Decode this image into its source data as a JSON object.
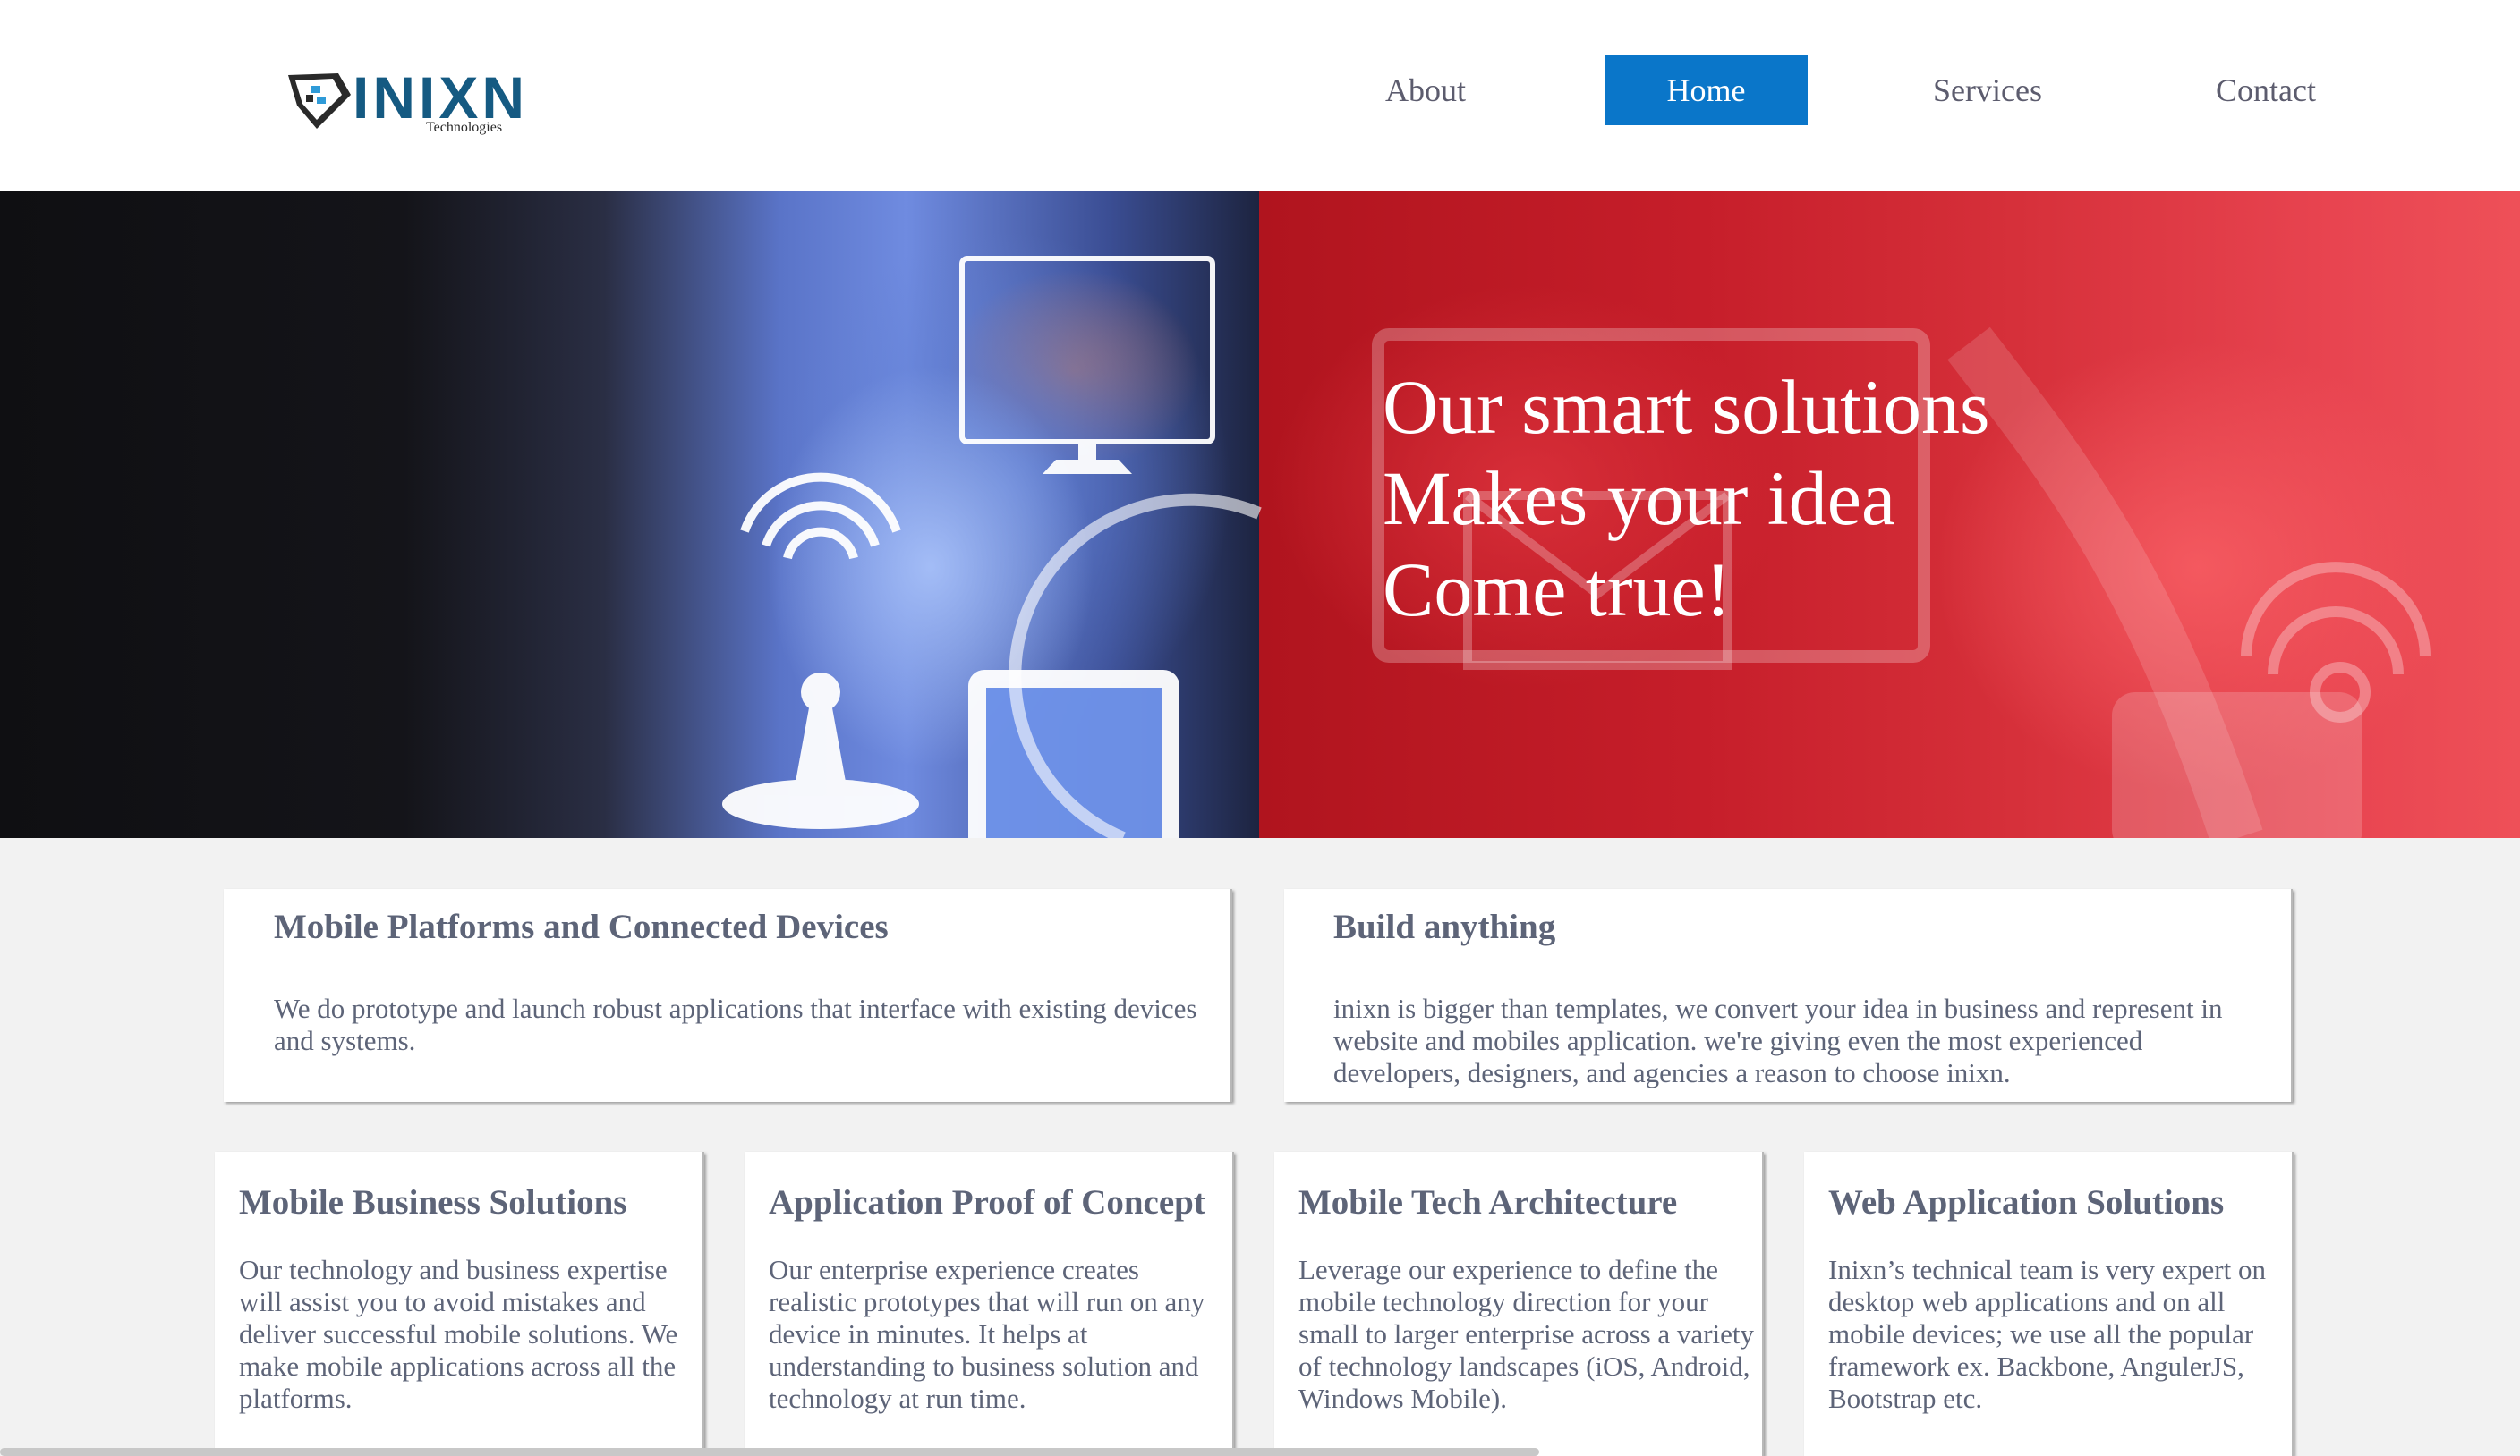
{
  "header": {
    "logo": {
      "name": "INIXN",
      "sub": "Technologies"
    },
    "nav": [
      {
        "label": "About",
        "active": false
      },
      {
        "label": "Home",
        "active": true
      },
      {
        "label": "Services",
        "active": false
      },
      {
        "label": "Contact",
        "active": false
      }
    ]
  },
  "hero": {
    "title_lines": [
      "Our smart solutions",
      "Makes your idea",
      "Come true!"
    ]
  },
  "features": [
    {
      "title": "Mobile Platforms and Connected Devices",
      "text": "We do prototype and launch robust applications that interface with existing devices and systems."
    },
    {
      "title": "Build anything",
      "text": "inixn is bigger than templates, we convert your idea in business and represent in website and mobiles application. we're giving even the most experienced developers, designers, and agencies a reason to choose inixn."
    }
  ],
  "services": [
    {
      "title": "Mobile Business Solutions",
      "text": "Our technology and business expertise will assist you to avoid mistakes and deliver successful mobile solutions. We make mobile applications across all the platforms."
    },
    {
      "title": "Application Proof of Concept",
      "text": "Our enterprise experience creates realistic prototypes that will run on any device in minutes. It helps at understanding to business solution and technology at run time."
    },
    {
      "title": "Mobile Tech Architecture",
      "text": "Leverage our experience to define the mobile technology direction for your small to larger enterprise across a variety of technology landscapes (iOS, Android, Windows Mobile)."
    },
    {
      "title": "Web Application Solutions",
      "text": "Inixn’s technical team is very expert on desktop web applications and on all mobile devices; we use all the popular framework ex. Backbone, AngulerJS, Bootstrap etc."
    }
  ],
  "colors": {
    "nav_active_bg": "#0a76c9",
    "logo_blue": "#155a82",
    "hero_red": "#c61e2a",
    "body_text": "#5d6478",
    "page_bg": "#f2f2f2"
  }
}
